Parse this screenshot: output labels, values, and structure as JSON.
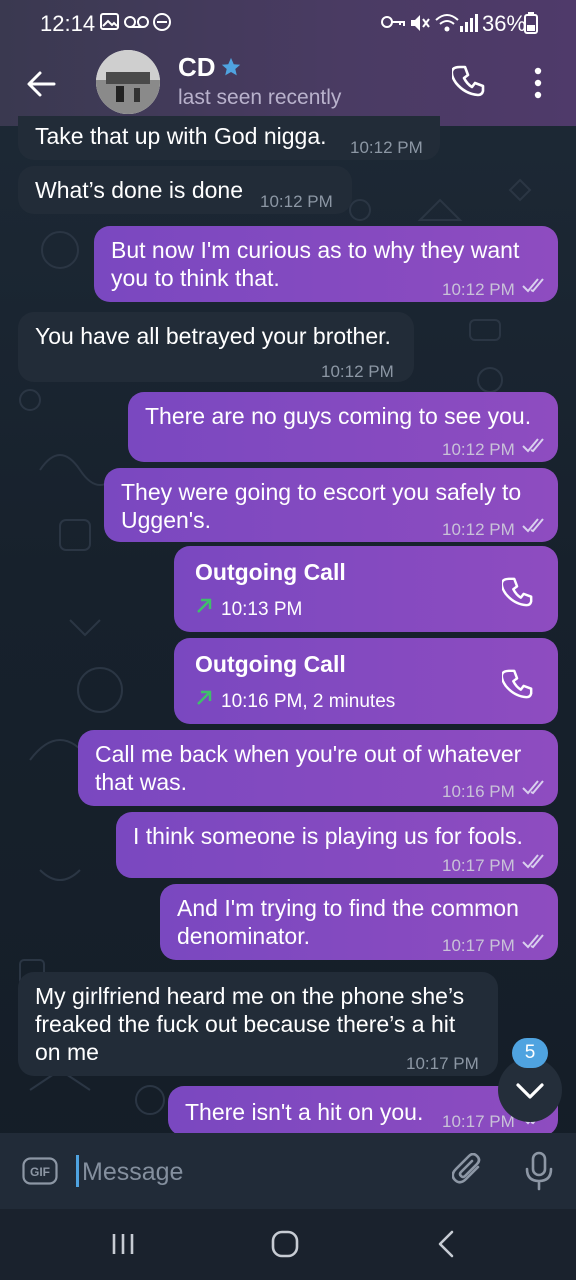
{
  "status_bar": {
    "time": "12:14",
    "battery": "36%"
  },
  "header": {
    "contact_name": "CD",
    "contact_status": "last seen recently"
  },
  "messages": [
    {
      "direction": "incoming",
      "text": "Take that up with God nigga.",
      "time": "10:12 PM"
    },
    {
      "direction": "incoming",
      "text": "What’s done is done",
      "time": "10:12 PM"
    },
    {
      "direction": "outgoing",
      "line1": "But now I'm curious as to why they want",
      "line2": "you to think that.",
      "time": "10:12 PM"
    },
    {
      "direction": "incoming",
      "text": "You have all betrayed your brother.",
      "time": "10:12 PM"
    },
    {
      "direction": "outgoing",
      "text": "There are no guys coming to see you.",
      "time": "10:12 PM"
    },
    {
      "direction": "outgoing",
      "line1": "They were going to escort you safely to",
      "line2": "Uggen's.",
      "time": "10:12 PM"
    },
    {
      "direction": "outgoing",
      "type": "call",
      "title": "Outgoing Call",
      "detail": "10:13 PM"
    },
    {
      "direction": "outgoing",
      "type": "call",
      "title": "Outgoing Call",
      "detail": "10:16 PM, 2 minutes"
    },
    {
      "direction": "outgoing",
      "line1": "Call me back when you're out of whatever",
      "line2": "that was.",
      "time": "10:16 PM"
    },
    {
      "direction": "outgoing",
      "text": "I think someone is playing us for fools.",
      "time": "10:17 PM"
    },
    {
      "direction": "outgoing",
      "line1": "And I'm trying to find the common",
      "line2": "denominator.",
      "time": "10:17 PM"
    },
    {
      "direction": "incoming",
      "line1": "My girlfriend heard me on the phone she’s",
      "line2": "freaked the fuck out because there’s a hit",
      "line3": "on me",
      "time": "10:17 PM"
    },
    {
      "direction": "outgoing",
      "text": "There isn't a hit on you.",
      "time": "10:17 PM"
    }
  ],
  "unread_count": "5",
  "input": {
    "gif_label": "GIF",
    "placeholder": "Message"
  },
  "colors": {
    "outgoing_bubble": "#8a4cc2",
    "incoming_bubble": "#222c38",
    "header": "#463a5e",
    "accent": "#4fa3e0",
    "call_arrow": "#3fbf6a"
  },
  "icons": [
    "back-arrow-icon",
    "star-icon",
    "phone-icon",
    "kebab-menu-icon",
    "double-check-icon",
    "call-outgoing-arrow-icon",
    "chevron-down-icon",
    "gif-icon",
    "paperclip-icon",
    "microphone-icon",
    "recent-apps-icon",
    "home-icon",
    "nav-back-icon"
  ]
}
